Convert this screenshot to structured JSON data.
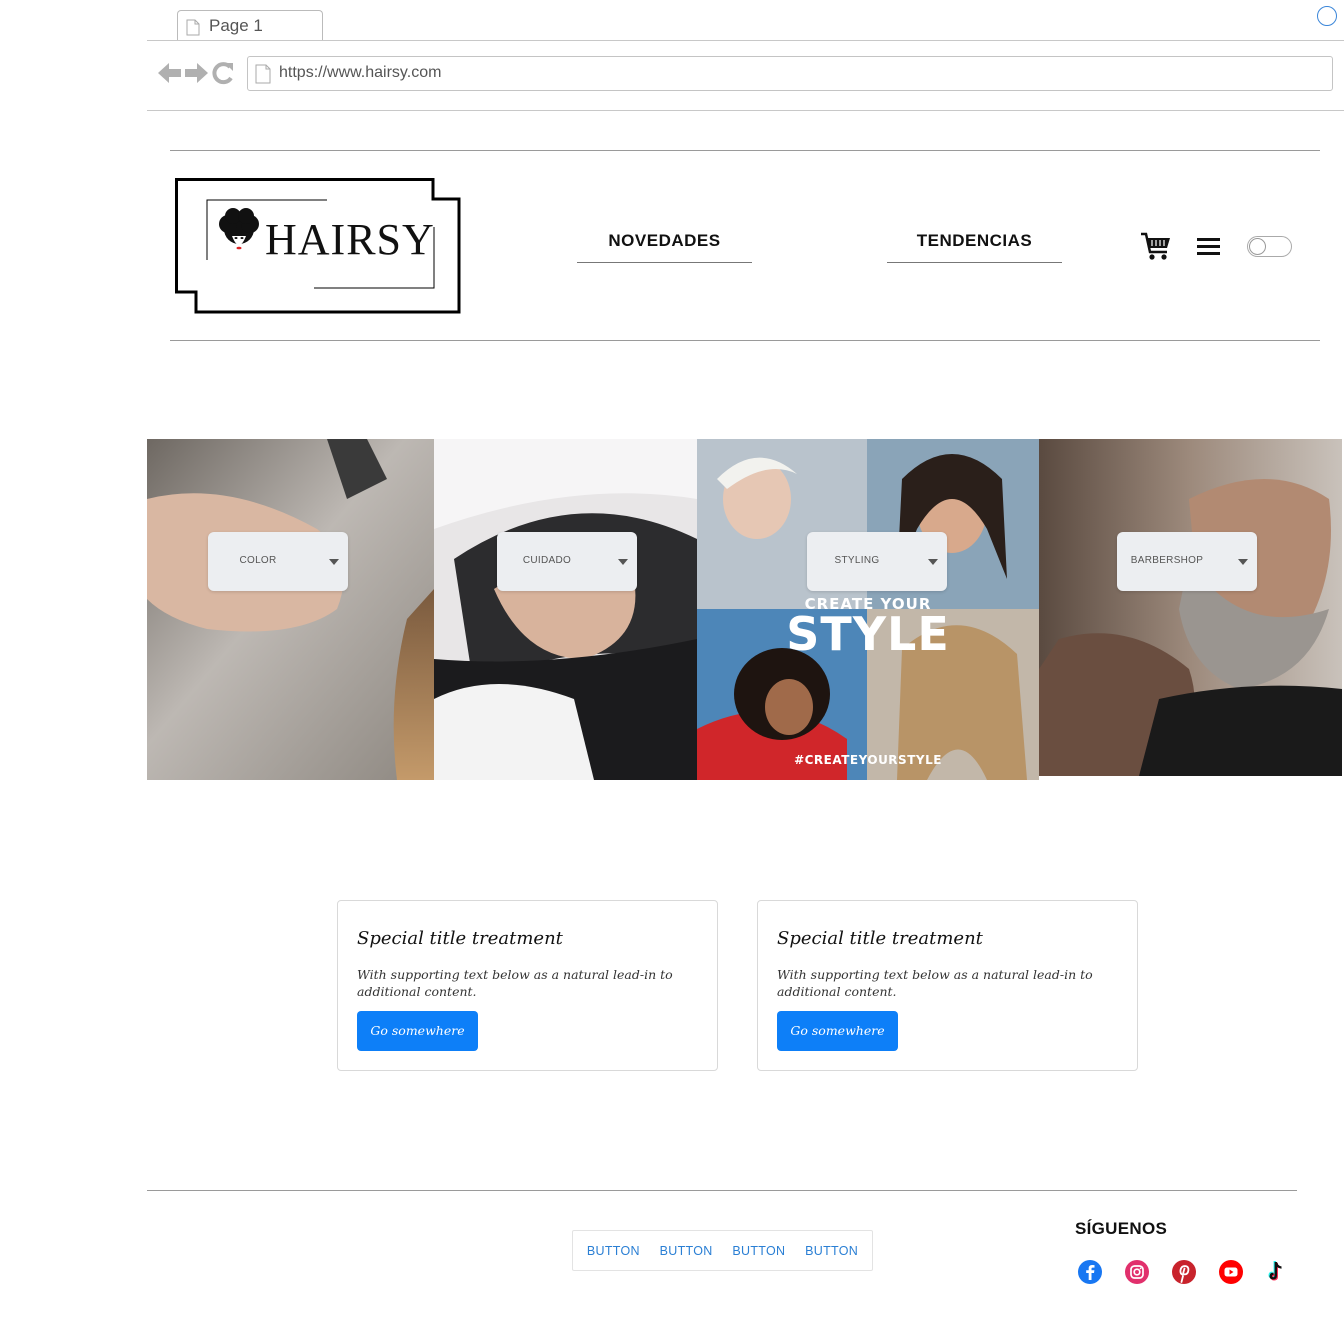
{
  "browser": {
    "tab_label": "Page 1",
    "url": "https://www.hairsy.com"
  },
  "header": {
    "logo_text": "HAIRSY",
    "nav": [
      {
        "label": "NOVEDADES"
      },
      {
        "label": "TENDENCIAS"
      }
    ],
    "icons": [
      "cart-icon",
      "menu-icon",
      "toggle-switch"
    ]
  },
  "hero": {
    "panels": [
      {
        "label": "COLOR"
      },
      {
        "label": "CUIDADO"
      },
      {
        "label": "STYLING",
        "overlay_title_small": "CREATE YOUR",
        "overlay_title_big": "STYLE",
        "hashtag": "#CREATEYOURSTYLE"
      },
      {
        "label": "BARBERSHOP"
      }
    ]
  },
  "cards": [
    {
      "title": "Special title treatment",
      "text": "With supporting text below as a natural lead-in to additional content.",
      "button": "Go somewhere"
    },
    {
      "title": "Special title treatment",
      "text": "With supporting text below as a natural lead-in to additional content.",
      "button": "Go somewhere"
    }
  ],
  "footer": {
    "buttons": [
      "BUTTON",
      "BUTTON",
      "BUTTON",
      "BUTTON"
    ],
    "follow_title": "SÍGUENOS",
    "social": [
      {
        "icon": "facebook-icon",
        "color": "#1877f2"
      },
      {
        "icon": "instagram-icon",
        "color": "#e1306c"
      },
      {
        "icon": "pinterest-icon",
        "color": "#c8232c"
      },
      {
        "icon": "youtube-icon",
        "color": "#ff0000"
      },
      {
        "icon": "tiktok-icon",
        "color": "#111111"
      }
    ]
  },
  "colors": {
    "primary_button": "#0d7ff8",
    "link_button": "#2a7fd4"
  }
}
